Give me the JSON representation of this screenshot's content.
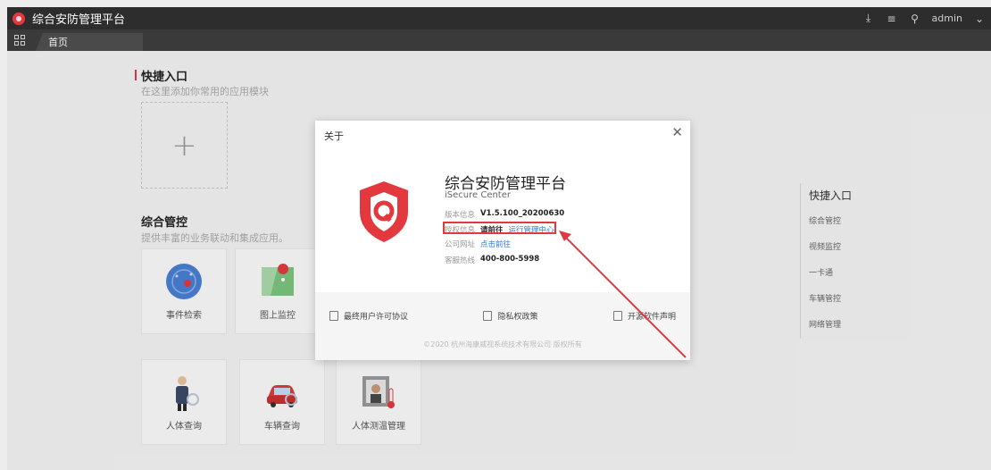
{
  "header": {
    "app_title": "综合安防管理平台",
    "user": "admin",
    "icons": [
      "download-icon",
      "menu-icon",
      "user-icon",
      "chevron-down-icon"
    ]
  },
  "tabs": [
    {
      "label": "首页"
    }
  ],
  "quick_entry": {
    "title": "快捷入口",
    "subtitle": "在这里添加你常用的应用模块"
  },
  "integrated": {
    "title": "综合管控",
    "subtitle": "提供丰富的业务联动和集成应用。",
    "cards": [
      {
        "label": "事件检索"
      },
      {
        "label": "图上监控"
      },
      {
        "label": "人体查询"
      },
      {
        "label": "车辆查询"
      },
      {
        "label": "人体测温管理"
      }
    ]
  },
  "right_nav": [
    "快捷入口",
    "综合管控",
    "视频监控",
    "一卡通",
    "车辆管控",
    "网络管理"
  ],
  "dialog": {
    "title": "关于",
    "product_name": "综合安防管理平台",
    "product_en": "iSecure Center",
    "version_label": "版本信息",
    "version_value": "V1.5.100_20200630",
    "license_label": "授权信息",
    "license_value": "请前往",
    "license_link": "运行管理中心",
    "website_label": "公司网址",
    "website_link": "点击前往",
    "hotline_label": "客服热线",
    "hotline_value": "400-800-5998",
    "footer_links": [
      "最终用户许可协议",
      "隐私权政策",
      "开源软件声明"
    ],
    "copyright": "©2020 杭州海康威视系统技术有限公司 版权所有"
  },
  "colors": {
    "accent": "#e2383e",
    "link": "#2b7bd6",
    "topbar": "#2d2d2d"
  }
}
